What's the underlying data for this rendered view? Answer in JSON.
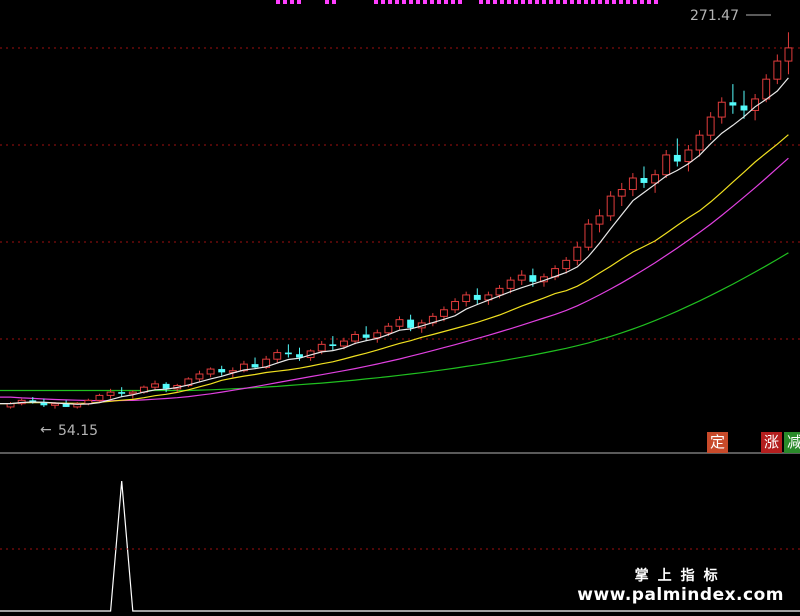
{
  "chart_data": {
    "type": "candlestick",
    "price_labels": {
      "high": "271.47",
      "low": "54.15"
    },
    "ylim": [
      30,
      285
    ],
    "colors": {
      "up": "#e03c3c",
      "down": "#54fcfc",
      "ma5": "#e8e8e8",
      "ma10": "#f0e020",
      "ma20": "#e040e0",
      "ma60": "#20c020",
      "signal": "#ff40ff",
      "grid": "#a01010"
    },
    "candles": [
      [
        44,
        47,
        43,
        46
      ],
      [
        46,
        49,
        45,
        48
      ],
      [
        48,
        50,
        46,
        47
      ],
      [
        47,
        49,
        44,
        45
      ],
      [
        45,
        47,
        43,
        46
      ],
      [
        46,
        48,
        44,
        44
      ],
      [
        44,
        47,
        43,
        46
      ],
      [
        46,
        49,
        45,
        48
      ],
      [
        48,
        52,
        47,
        51
      ],
      [
        51,
        55,
        49,
        53
      ],
      [
        53,
        56,
        50,
        52
      ],
      [
        52,
        54,
        49,
        53
      ],
      [
        53,
        57,
        52,
        56
      ],
      [
        56,
        60,
        54,
        58
      ],
      [
        58,
        59,
        53,
        55
      ],
      [
        55,
        58,
        53,
        57
      ],
      [
        57,
        62,
        56,
        61
      ],
      [
        61,
        66,
        59,
        64
      ],
      [
        64,
        68,
        62,
        67
      ],
      [
        67,
        69,
        63,
        65
      ],
      [
        65,
        68,
        62,
        66
      ],
      [
        66,
        72,
        65,
        70
      ],
      [
        70,
        74,
        67,
        68
      ],
      [
        68,
        75,
        67,
        73
      ],
      [
        73,
        79,
        71,
        77
      ],
      [
        77,
        82,
        74,
        76
      ],
      [
        76,
        80,
        72,
        74
      ],
      [
        74,
        79,
        72,
        78
      ],
      [
        78,
        84,
        76,
        82
      ],
      [
        82,
        87,
        78,
        81
      ],
      [
        81,
        86,
        79,
        84
      ],
      [
        84,
        90,
        82,
        88
      ],
      [
        88,
        93,
        84,
        86
      ],
      [
        86,
        91,
        83,
        89
      ],
      [
        89,
        95,
        87,
        93
      ],
      [
        93,
        99,
        91,
        97
      ],
      [
        97,
        100,
        90,
        92
      ],
      [
        92,
        97,
        89,
        95
      ],
      [
        95,
        101,
        93,
        99
      ],
      [
        99,
        105,
        96,
        103
      ],
      [
        103,
        110,
        101,
        108
      ],
      [
        108,
        114,
        105,
        112
      ],
      [
        112,
        116,
        106,
        109
      ],
      [
        109,
        114,
        106,
        112
      ],
      [
        112,
        118,
        110,
        116
      ],
      [
        116,
        123,
        113,
        121
      ],
      [
        121,
        127,
        118,
        124
      ],
      [
        124,
        128,
        117,
        120
      ],
      [
        120,
        125,
        117,
        123
      ],
      [
        123,
        130,
        121,
        128
      ],
      [
        128,
        135,
        125,
        133
      ],
      [
        133,
        144,
        130,
        141
      ],
      [
        141,
        158,
        139,
        155
      ],
      [
        155,
        164,
        150,
        160
      ],
      [
        160,
        175,
        157,
        172
      ],
      [
        172,
        180,
        166,
        176
      ],
      [
        176,
        186,
        172,
        183
      ],
      [
        183,
        190,
        177,
        180
      ],
      [
        180,
        188,
        174,
        185
      ],
      [
        185,
        200,
        183,
        197
      ],
      [
        197,
        207,
        190,
        193
      ],
      [
        193,
        203,
        187,
        200
      ],
      [
        200,
        212,
        196,
        209
      ],
      [
        209,
        223,
        206,
        220
      ],
      [
        220,
        232,
        216,
        229
      ],
      [
        229,
        240,
        222,
        227
      ],
      [
        227,
        236,
        219,
        224
      ],
      [
        224,
        234,
        218,
        231
      ],
      [
        231,
        246,
        229,
        243
      ],
      [
        243,
        258,
        240,
        254
      ],
      [
        254,
        271.47,
        246,
        262
      ]
    ],
    "ma5": [
      46,
      46.7,
      47,
      46.9,
      46.4,
      46,
      45.6,
      45.8,
      46.6,
      48.4,
      50.2,
      51.4,
      53,
      54.4,
      54.8,
      55.8,
      57.4,
      59.2,
      61,
      62.6,
      64.6,
      66.4,
      67.2,
      68.4,
      70.6,
      72.8,
      73.6,
      75.6,
      77.4,
      78.2,
      79.8,
      82.6,
      84.2,
      85.6,
      88,
      90.6,
      91.4,
      93.2,
      95.2,
      97.2,
      99.4,
      103.4,
      106.2,
      108.8,
      111.4,
      114,
      116.4,
      118.6,
      120.8,
      123.2,
      125.6,
      129,
      135.4,
      143.4,
      152.2,
      160.8,
      169.2,
      174.2,
      179.2,
      184.2,
      187.6,
      191.6,
      196.8,
      203.8,
      210.2,
      215,
      220.2,
      226.2,
      230.8,
      235.8,
      243.8
    ],
    "ma10": [
      46,
      46.5,
      46.7,
      46.6,
      46.4,
      46.3,
      46.2,
      46.3,
      46.8,
      47.4,
      48.1,
      48.6,
      49.6,
      50.8,
      51.7,
      52.8,
      54.4,
      56.2,
      58,
      60.2,
      61.5,
      62.7,
      63.7,
      64.9,
      65.7,
      66.5,
      67.5,
      68.8,
      70.2,
      71.4,
      73.1,
      74.9,
      76.6,
      78.5,
      80.6,
      82.6,
      84.2,
      86.3,
      88,
      89.8,
      91.6,
      93.5,
      95.4,
      97.6,
      99.8,
      102.5,
      105.2,
      107.7,
      110.2,
      112.8,
      114.6,
      117.3,
      121.1,
      125.3,
      129.4,
      133.9,
      138.1,
      141.4,
      144.8,
      149.5,
      154.2,
      158.9,
      163.1,
      168.5,
      174.4,
      180.5,
      186.5,
      192.7,
      198.2,
      203.5,
      209.3
    ],
    "ma20": [
      50,
      49.5,
      49.2,
      48.8,
      48.5,
      48.3,
      48.1,
      47.9,
      47.8,
      47.8,
      47.9,
      48,
      48.3,
      48.7,
      49.1,
      49.6,
      50.3,
      51.1,
      52,
      53,
      54.1,
      55.2,
      56.3,
      57.5,
      58.8,
      60,
      61.2,
      62.4,
      63.6,
      64.8,
      66,
      67.3,
      68.7,
      70.1,
      71.6,
      73.1,
      74.8,
      76.5,
      78.2,
      80,
      81.8,
      83.7,
      85.6,
      87.5,
      89.5,
      91.5,
      93.6,
      95.8,
      98,
      100.2,
      102.6,
      105.4,
      108.6,
      112,
      115.6,
      119.4,
      123.3,
      127.4,
      131.6,
      136,
      140.5,
      145.2,
      150,
      155,
      160.3,
      165.8,
      171.4,
      177.1,
      183,
      189,
      195
    ],
    "ma60": [
      54,
      54,
      54,
      54,
      54,
      54,
      54,
      54,
      54,
      54,
      54,
      54,
      54,
      54,
      54,
      54,
      54,
      54.2,
      54.4,
      54.7,
      55,
      55.3,
      55.7,
      56.1,
      56.5,
      57,
      57.5,
      58,
      58.5,
      59.1,
      59.7,
      60.3,
      61,
      61.7,
      62.4,
      63.2,
      64,
      64.8,
      65.7,
      66.6,
      67.6,
      68.6,
      69.6,
      70.7,
      71.8,
      73,
      74.2,
      75.5,
      76.8,
      78.2,
      79.6,
      81.2,
      82.9,
      84.8,
      86.8,
      89,
      91.3,
      93.8,
      96.4,
      99.2,
      102.1,
      105.2,
      108.4,
      111.7,
      115.1,
      118.6,
      122.2,
      125.9,
      129.7,
      133.6,
      137.6
    ],
    "signal_series": [
      0,
      0,
      0,
      0,
      0,
      0,
      0,
      0,
      0,
      0,
      1,
      0,
      0,
      0,
      0,
      0,
      0,
      0,
      0,
      0,
      0,
      0,
      0,
      0,
      0,
      0,
      0,
      0,
      0,
      0,
      0,
      0,
      0,
      0,
      0,
      0,
      0,
      0,
      0,
      0,
      0,
      0,
      0,
      0,
      0,
      0,
      0,
      0,
      0,
      0,
      0,
      0,
      0,
      0,
      0,
      0,
      0,
      0,
      0,
      0,
      0,
      0,
      0,
      0,
      0,
      0,
      0,
      0,
      0,
      0,
      0
    ],
    "tags": [
      {
        "text": "定",
        "color": "#c84a2a"
      },
      {
        "text": "涨",
        "color": "#b41e1e"
      },
      {
        "text": "减",
        "color": "#2a8a2a"
      }
    ]
  },
  "watermark": {
    "line1": "掌上指标",
    "line2": "www.palmindex.com"
  }
}
